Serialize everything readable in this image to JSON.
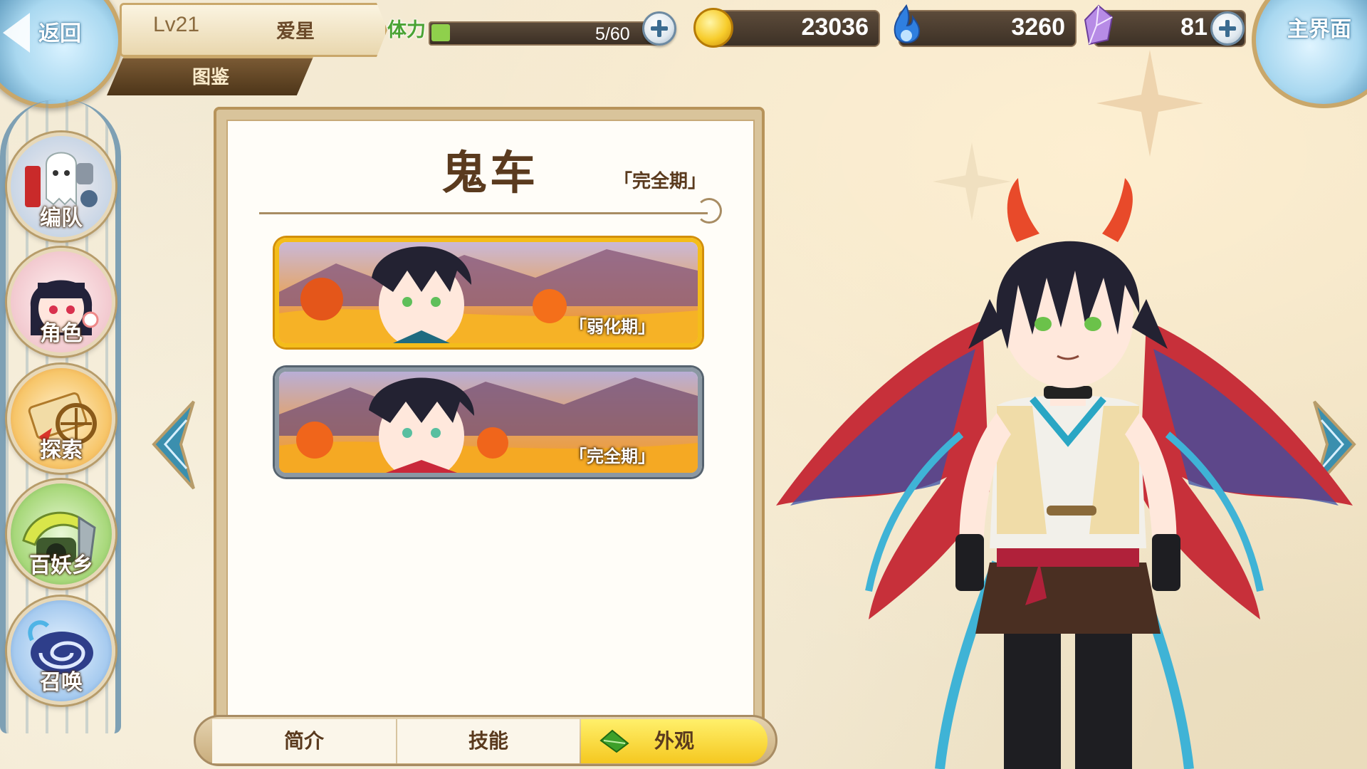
{
  "topbar": {
    "back_label": "返回",
    "level": "Lv21",
    "player_name": "爱星",
    "section_tab": "图鉴",
    "stamina_label": "体力",
    "stamina_text": "5/60",
    "stamina_fraction": 0.0833,
    "gold": "23036",
    "soul_fire": "3260",
    "crystal": "81",
    "home_label": "主界面"
  },
  "nav": {
    "items": [
      {
        "label": "编队",
        "icon": "ghost-helmet-icon"
      },
      {
        "label": "角色",
        "icon": "girl-portrait-icon"
      },
      {
        "label": "探索",
        "icon": "map-scroll-icon"
      },
      {
        "label": "百妖乡",
        "icon": "village-hut-icon"
      },
      {
        "label": "召唤",
        "icon": "summon-swirl-icon"
      }
    ]
  },
  "codex": {
    "name": "鬼车",
    "phase": "「完全期」",
    "skins": [
      {
        "label": "「弱化期」",
        "selected": true
      },
      {
        "label": "「完全期」",
        "selected": false
      }
    ]
  },
  "tabs": {
    "intro": "简介",
    "skills": "技能",
    "looks": "外观",
    "active": "looks"
  },
  "colors": {
    "accent_gold": "#f4bd1a",
    "panel_brown": "#5a3a1e",
    "stamina_green": "#8fd04c",
    "sky_blue": "#a9d8f0"
  }
}
